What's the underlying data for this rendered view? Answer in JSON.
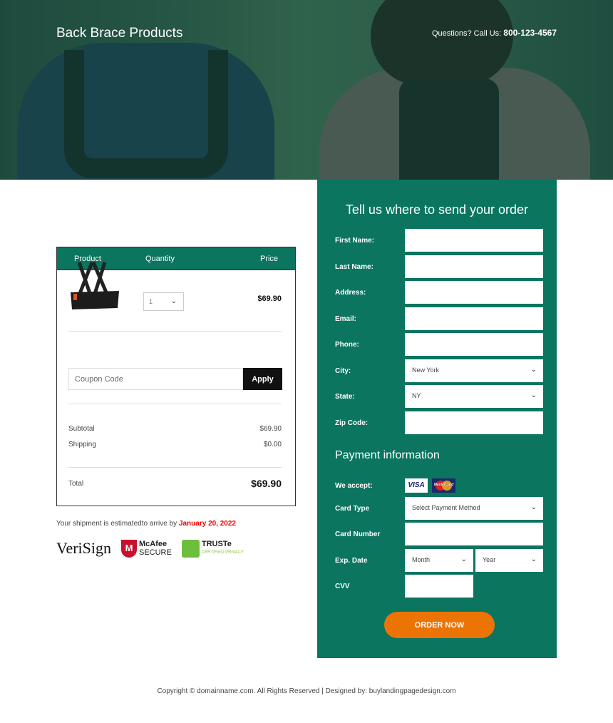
{
  "header": {
    "brand": "Back Brace Products",
    "phone_label": "Questions? Call Us:",
    "phone": "800-123-4567"
  },
  "cart": {
    "columns": [
      "Product",
      "Quantity",
      "Price"
    ],
    "item": {
      "qty": "1",
      "price": "$69.90"
    },
    "coupon_placeholder": "Coupon Code",
    "apply": "Apply",
    "subtotal_label": "Subtotal",
    "subtotal": "$69.90",
    "shipping_label": "Shipping",
    "shipping": "$0.00",
    "total_label": "Total",
    "total": "$69.90"
  },
  "shipment": {
    "text": "Your shipment is estimatedto arrive by",
    "date": "January 20, 2022"
  },
  "seals": [
    "VeriSign",
    "McAfee SECURE",
    "TRUSTe CERTIFIED PRIVACY"
  ],
  "form": {
    "title": "Tell us where to send your order",
    "fields": [
      {
        "label": "First Name:",
        "value": ""
      },
      {
        "label": "Last Name:",
        "value": ""
      },
      {
        "label": "Address:",
        "value": ""
      },
      {
        "label": "Email:",
        "value": ""
      },
      {
        "label": "Phone:",
        "value": ""
      },
      {
        "label": "City:",
        "value": "New York"
      },
      {
        "label": "State:",
        "value": "NY"
      },
      {
        "label": "Zip Code:",
        "value": ""
      }
    ],
    "payment_title": "Payment information",
    "accept_label": "We accept:",
    "cards": [
      "VISA",
      "MasterCard"
    ],
    "card_type_label": "Card Type",
    "card_type": "Select Payment Method",
    "card_number_label": "Card Number",
    "exp_label": "Exp. Date",
    "month": "Month",
    "year": "Year",
    "cvv_label": "CVV",
    "order": "ORDER NOW"
  },
  "footer": "Copyright © domainname.com. All Rights Reserved | Designed by: buylandingpagedesign.com",
  "colors": {
    "green": "#0b7560",
    "orange": "#ec7405",
    "date_red": "#ee0000"
  }
}
